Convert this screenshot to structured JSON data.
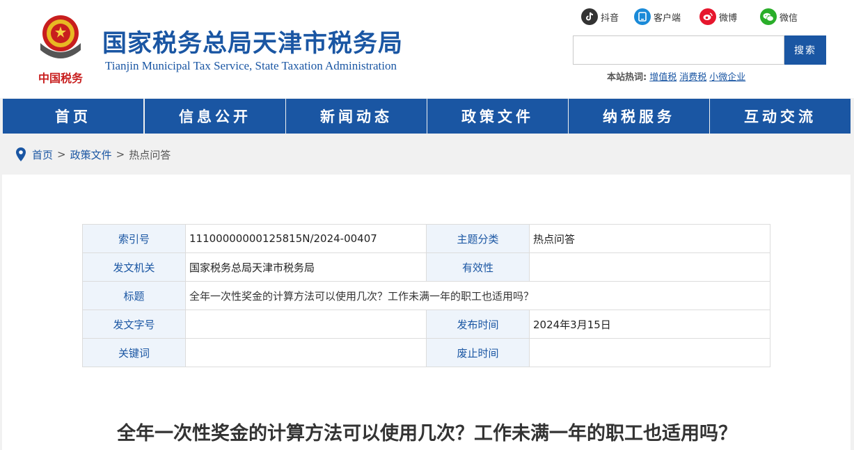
{
  "header": {
    "title": "国家税务总局天津市税务局",
    "subtitle": "Tianjin Municipal Tax Service, State Taxation Administration",
    "emblem_text": "中国税务",
    "social": [
      {
        "label": "抖音",
        "icon": "douyin-icon"
      },
      {
        "label": "客户端",
        "icon": "client-icon"
      },
      {
        "label": "微博",
        "icon": "weibo-icon"
      },
      {
        "label": "微信",
        "icon": "wechat-icon"
      }
    ],
    "search": {
      "value": "",
      "button": "搜索"
    },
    "hot": {
      "label": "本站热词:",
      "words": [
        "增值税",
        "消费税",
        "小微企业"
      ]
    }
  },
  "nav": [
    "首页",
    "信息公开",
    "新闻动态",
    "政策文件",
    "纳税服务",
    "互动交流"
  ],
  "breadcrumb": {
    "items": [
      "首页",
      "政策文件",
      "热点问答"
    ],
    "separator": ">"
  },
  "meta": {
    "rows": [
      {
        "k1": "索引号",
        "v1": "11100000000125815N/2024-00407",
        "k2": "主题分类",
        "v2": "热点问答"
      },
      {
        "k1": "发文机关",
        "v1": "国家税务总局天津市税务局",
        "k2": "有效性",
        "v2": ""
      },
      {
        "k1": "标题",
        "v1": "全年一次性奖金的计算方法可以使用几次？工作未满一年的职工也适用吗？"
      },
      {
        "k1": "发文字号",
        "v1": "",
        "k2": "发布时间",
        "v2": "2024年3月15日"
      },
      {
        "k1": "关键词",
        "v1": "",
        "k2": "废止时间",
        "v2": ""
      }
    ]
  },
  "article": {
    "title": "全年一次性奖金的计算方法可以使用几次？工作未满一年的职工也适用吗？"
  },
  "colors": {
    "brand": "#1a56a3",
    "accent_red": "#c81e1e",
    "meta_key_bg": "#eef4fb"
  }
}
